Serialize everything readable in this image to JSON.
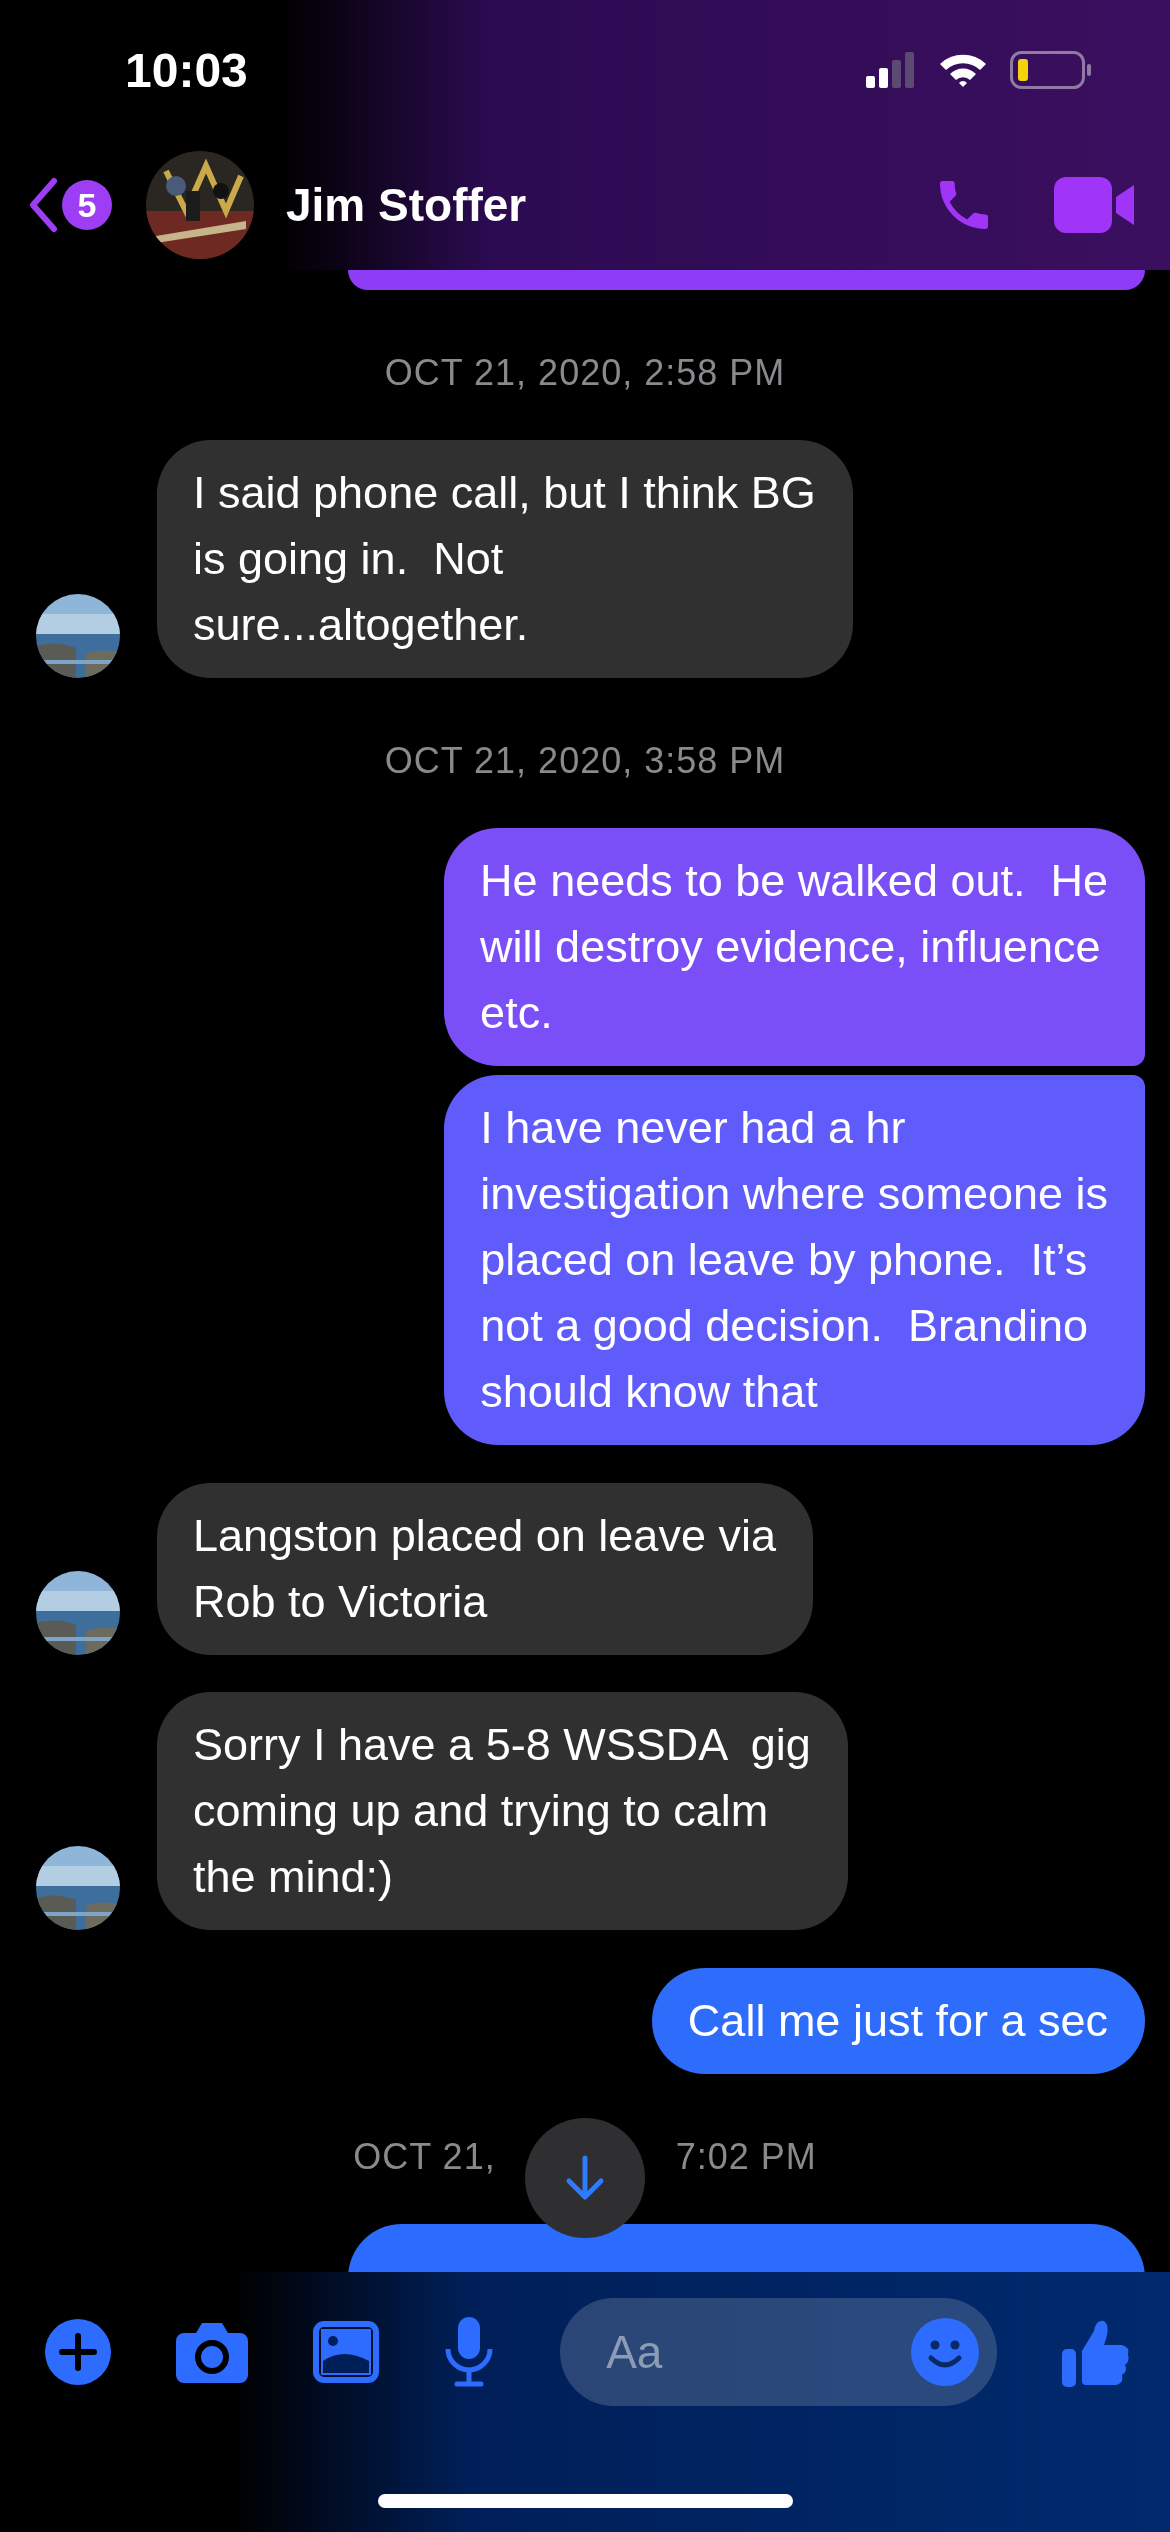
{
  "status_bar": {
    "time": "10:03"
  },
  "header": {
    "back_badge": "5",
    "contact_name": "Jim Stoffer"
  },
  "messages": [
    {
      "kind": "edge",
      "color": "#8e3cf6"
    },
    {
      "kind": "timestamp",
      "parts": [
        "OCT 21, 2020, 2:58 PM"
      ]
    },
    {
      "kind": "incoming",
      "text": "I said phone call, but I think BG\nis going in.  Not\nsure...altogether."
    },
    {
      "kind": "timestamp",
      "parts": [
        "OCT 21, 2020, 3:58 PM"
      ]
    },
    {
      "kind": "outgoing",
      "color": "#7a4ff7",
      "text": "He needs to be walked out.  He\nwill destroy evidence, influence\netc."
    },
    {
      "kind": "outgoing",
      "color": "#5f5cfb",
      "text": "I have never had a hr\ninvestigation where someone is\nplaced on leave by phone.  It’s\nnot a good decision.  Brandino\nshould know that"
    },
    {
      "kind": "incoming",
      "text": "Langston placed on leave via\nRob to Victoria"
    },
    {
      "kind": "incoming",
      "text": "Sorry I have a 5-8 WSSDA  gig\ncoming up and trying to calm\nthe mind:)"
    },
    {
      "kind": "outgoing",
      "color": "#2e6cfb",
      "text": "Call me just for a sec"
    },
    {
      "kind": "timestamp",
      "parts": [
        "OCT 21,",
        "7:02 PM"
      ]
    },
    {
      "kind": "cut",
      "color": "#2b6cff"
    }
  ],
  "composer": {
    "placeholder": "Aa"
  }
}
